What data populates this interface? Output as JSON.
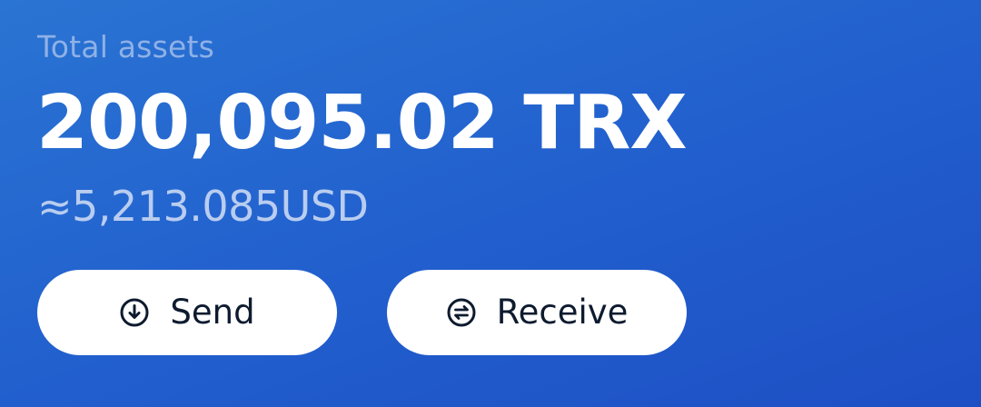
{
  "assets": {
    "label": "Total assets",
    "balance": "200,095.02 TRX",
    "fiat_value": "≈5,213.085USD"
  },
  "actions": {
    "send": {
      "label": "Send",
      "icon": "arrow-down-circle-icon"
    },
    "receive": {
      "label": "Receive",
      "icon": "swap-circle-icon"
    }
  },
  "colors": {
    "background_start": "#2a74d3",
    "background_end": "#1d4fc4",
    "button_background": "#ffffff",
    "button_text": "#0e1b2f",
    "label_text": "#8fb1e6",
    "fiat_text": "#b9cdf0"
  }
}
